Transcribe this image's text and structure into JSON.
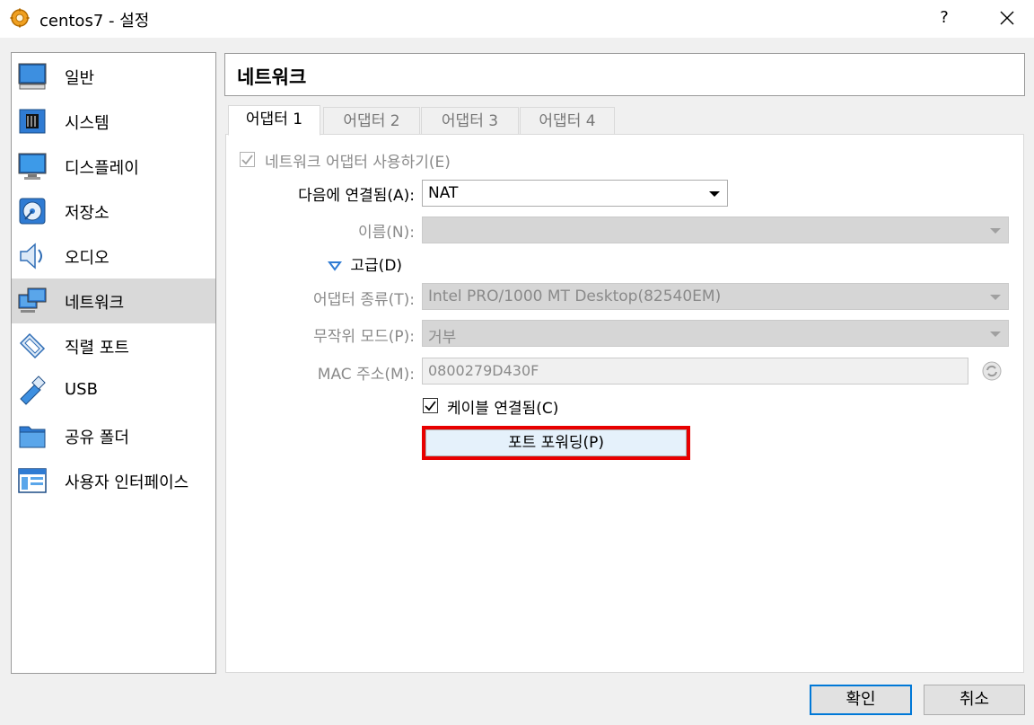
{
  "window": {
    "title": "centos7 - 설정",
    "help_label": "?",
    "icon": "virtualbox-gear-icon"
  },
  "sidebar": {
    "items": [
      {
        "label": "일반",
        "icon": "monitor-icon"
      },
      {
        "label": "시스템",
        "icon": "chip-icon"
      },
      {
        "label": "디스플레이",
        "icon": "display-icon"
      },
      {
        "label": "저장소",
        "icon": "disk-icon"
      },
      {
        "label": "오디오",
        "icon": "speaker-icon"
      },
      {
        "label": "네트워크",
        "icon": "network-icon",
        "selected": true
      },
      {
        "label": "직렬 포트",
        "icon": "serial-port-icon"
      },
      {
        "label": "USB",
        "icon": "usb-icon"
      },
      {
        "label": "공유 폴더",
        "icon": "folder-icon"
      },
      {
        "label": "사용자 인터페이스",
        "icon": "ui-window-icon"
      }
    ]
  },
  "header": {
    "title": "네트워크"
  },
  "tabs": [
    {
      "label": "어댑터 1",
      "active": true
    },
    {
      "label": "어댑터 2"
    },
    {
      "label": "어댑터 3"
    },
    {
      "label": "어댑터 4"
    }
  ],
  "form": {
    "enable_adapter": {
      "label": "네트워크 어댑터 사용하기(E)",
      "checked": true,
      "enabled": false
    },
    "attached_to": {
      "label": "다음에 연결됨(A):",
      "value": "NAT"
    },
    "name": {
      "label": "이름(N):",
      "value": ""
    },
    "advanced": {
      "label": "고급(D)"
    },
    "adapter_type": {
      "label": "어댑터 종류(T):",
      "value": "Intel PRO/1000 MT Desktop(82540EM)"
    },
    "promiscuous": {
      "label": "무작위 모드(P):",
      "value": "거부"
    },
    "mac": {
      "label": "MAC 주소(M):",
      "value": "0800279D430F",
      "refresh_icon": "refresh-icon"
    },
    "cable": {
      "label": "케이블 연결됨(C)",
      "checked": true
    },
    "port_forwarding": {
      "label": "포트 포워딩(P)"
    }
  },
  "footer": {
    "ok_label": "확인",
    "cancel_label": "취소"
  },
  "colors": {
    "highlight_outline": "#e80000",
    "default_button_border": "#0078d7",
    "selected_sidebar": "#d9d9d9"
  }
}
